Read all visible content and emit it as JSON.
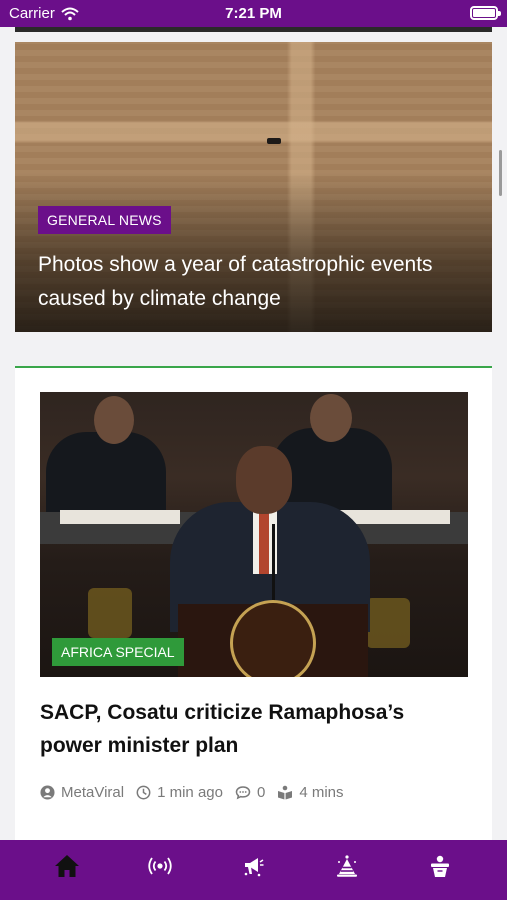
{
  "status_bar": {
    "carrier": "Carrier",
    "time": "7:21 PM",
    "icons": [
      "wifi-icon",
      "battery-icon"
    ]
  },
  "feed": {
    "featured": {
      "category": "GENERAL NEWS",
      "headline": "Photos show a year of catastrophic events caused by climate change",
      "badge_color": "#6b0f8a"
    },
    "article": {
      "category": "AFRICA SPECIAL",
      "badge_color": "#2f9a3a",
      "title": "SACP, Cosatu criticize Ramaphosa’s power minister plan",
      "author": "MetaViral",
      "time_ago": "1 min ago",
      "comments": "0",
      "read_time": "4 mins"
    }
  },
  "tab_bar": {
    "background": "#6b0f8a",
    "tabs": [
      {
        "icon": "home-icon",
        "active": true
      },
      {
        "icon": "broadcast-icon",
        "active": false
      },
      {
        "icon": "megaphone-icon",
        "active": false
      },
      {
        "icon": "party-icon",
        "active": false
      },
      {
        "icon": "award-icon",
        "active": false
      }
    ]
  }
}
